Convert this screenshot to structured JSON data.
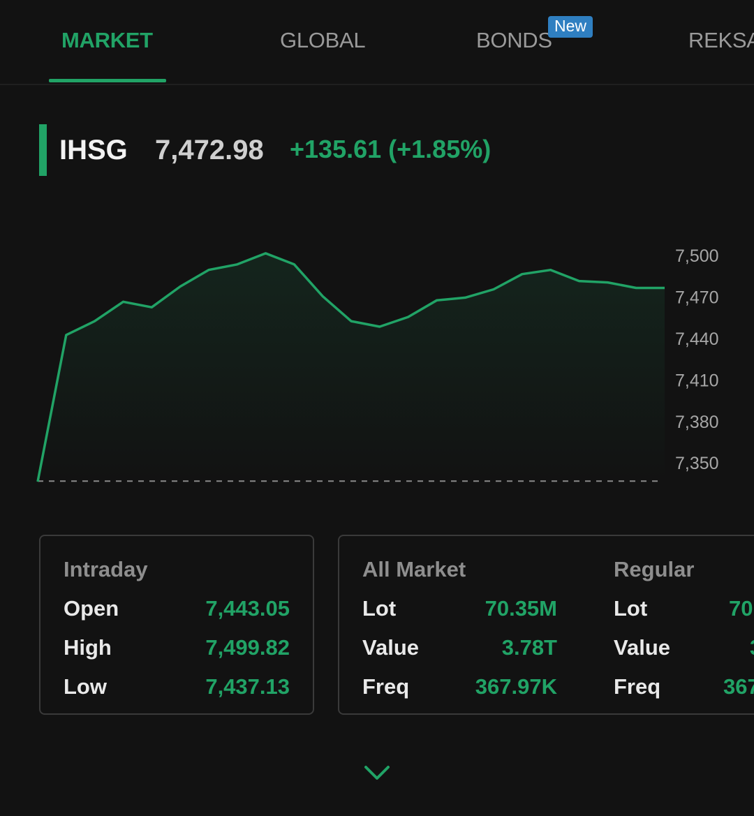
{
  "tabs": [
    {
      "label": "MARKET",
      "active": true
    },
    {
      "label": "GLOBAL",
      "active": false
    },
    {
      "label": "BONDS",
      "active": false,
      "badge": "New"
    },
    {
      "label": "REKSA",
      "active": false
    }
  ],
  "index": {
    "name": "IHSG",
    "value": "7,472.98",
    "change": "+135.61 (+1.85%)"
  },
  "chart_data": {
    "type": "area",
    "y_ticks": [
      "7,500",
      "7,470",
      "7,440",
      "7,410",
      "7,380",
      "7,350"
    ],
    "ylim": [
      7337,
      7506
    ],
    "baseline": 7337.37,
    "series": [
      {
        "values": [
          7337,
          7443,
          7453,
          7467,
          7463,
          7478,
          7490,
          7494,
          7502,
          7494,
          7471,
          7453,
          7449,
          7456,
          7468,
          7470,
          7476,
          7487,
          7490,
          7482,
          7481,
          7477,
          7477
        ]
      }
    ],
    "colors": {
      "line": "#21a366",
      "fill": "#21a366"
    }
  },
  "intraday": {
    "title": "Intraday",
    "rows": [
      {
        "label": "Open",
        "value": "7,443.05"
      },
      {
        "label": "High",
        "value": "7,499.82"
      },
      {
        "label": "Low",
        "value": "7,437.13"
      }
    ]
  },
  "all_market": {
    "title": "All Market",
    "rows": [
      {
        "label": "Lot",
        "value": "70.35M"
      },
      {
        "label": "Value",
        "value": "3.78T"
      },
      {
        "label": "Freq",
        "value": "367.97K"
      }
    ]
  },
  "regular": {
    "title": "Regular",
    "rows": [
      {
        "label": "Lot",
        "value": "70"
      },
      {
        "label": "Value",
        "value": "3"
      },
      {
        "label": "Freq",
        "value": "367"
      }
    ]
  },
  "icons": {
    "expand": "chevron-down-icon"
  },
  "colors": {
    "accent": "#21a366",
    "background": "#121212",
    "badge": "#2f7fc1"
  }
}
